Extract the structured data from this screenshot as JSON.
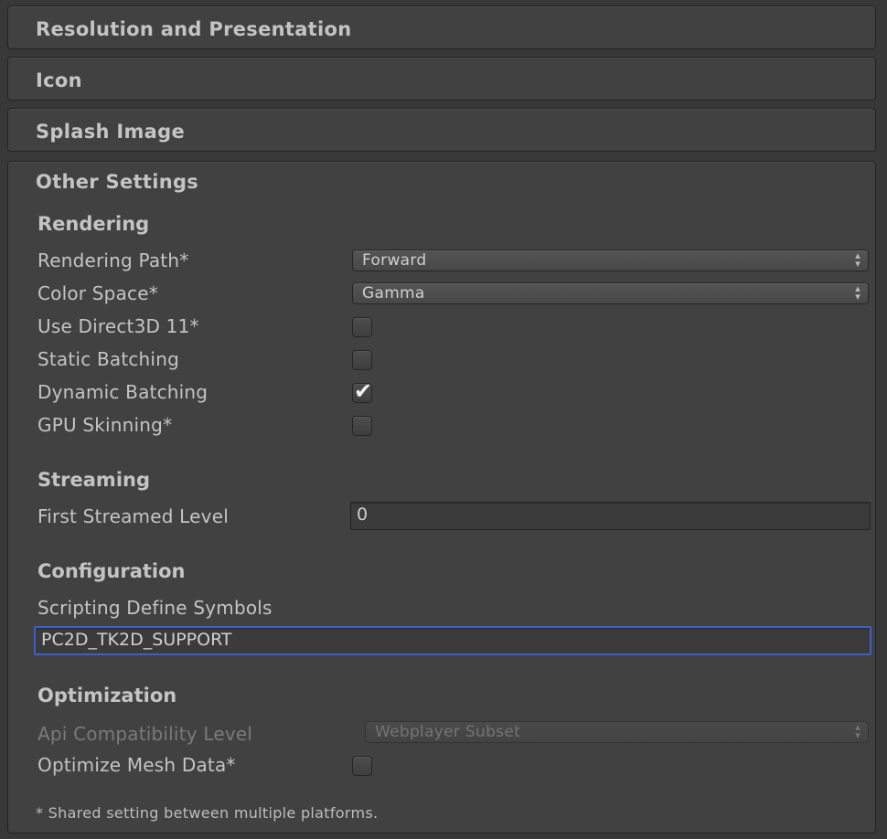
{
  "sections": {
    "resolution": "Resolution and Presentation",
    "icon": "Icon",
    "splash": "Splash Image",
    "other": "Other Settings"
  },
  "rendering": {
    "heading": "Rendering",
    "rendering_path_label": "Rendering Path*",
    "rendering_path_value": "Forward",
    "color_space_label": "Color Space*",
    "color_space_value": "Gamma",
    "use_d3d11_label": "Use Direct3D 11*",
    "use_d3d11_checked": false,
    "static_batching_label": "Static Batching",
    "static_batching_checked": false,
    "dynamic_batching_label": "Dynamic Batching",
    "dynamic_batching_checked": true,
    "gpu_skinning_label": "GPU Skinning*",
    "gpu_skinning_checked": false
  },
  "streaming": {
    "heading": "Streaming",
    "first_level_label": "First Streamed Level",
    "first_level_value": "0"
  },
  "configuration": {
    "heading": "Configuration",
    "define_symbols_label": "Scripting Define Symbols",
    "define_symbols_value": "PC2D_TK2D_SUPPORT"
  },
  "optimization": {
    "heading": "Optimization",
    "api_level_label": "Api Compatibility Level",
    "api_level_value": "Webplayer Subset",
    "optimize_mesh_label": "Optimize Mesh Data*",
    "optimize_mesh_checked": false
  },
  "footnote": "* Shared setting between multiple platforms.",
  "glyphs": {
    "checkmark": "✔",
    "dropdown_arrows": "▴▾"
  }
}
